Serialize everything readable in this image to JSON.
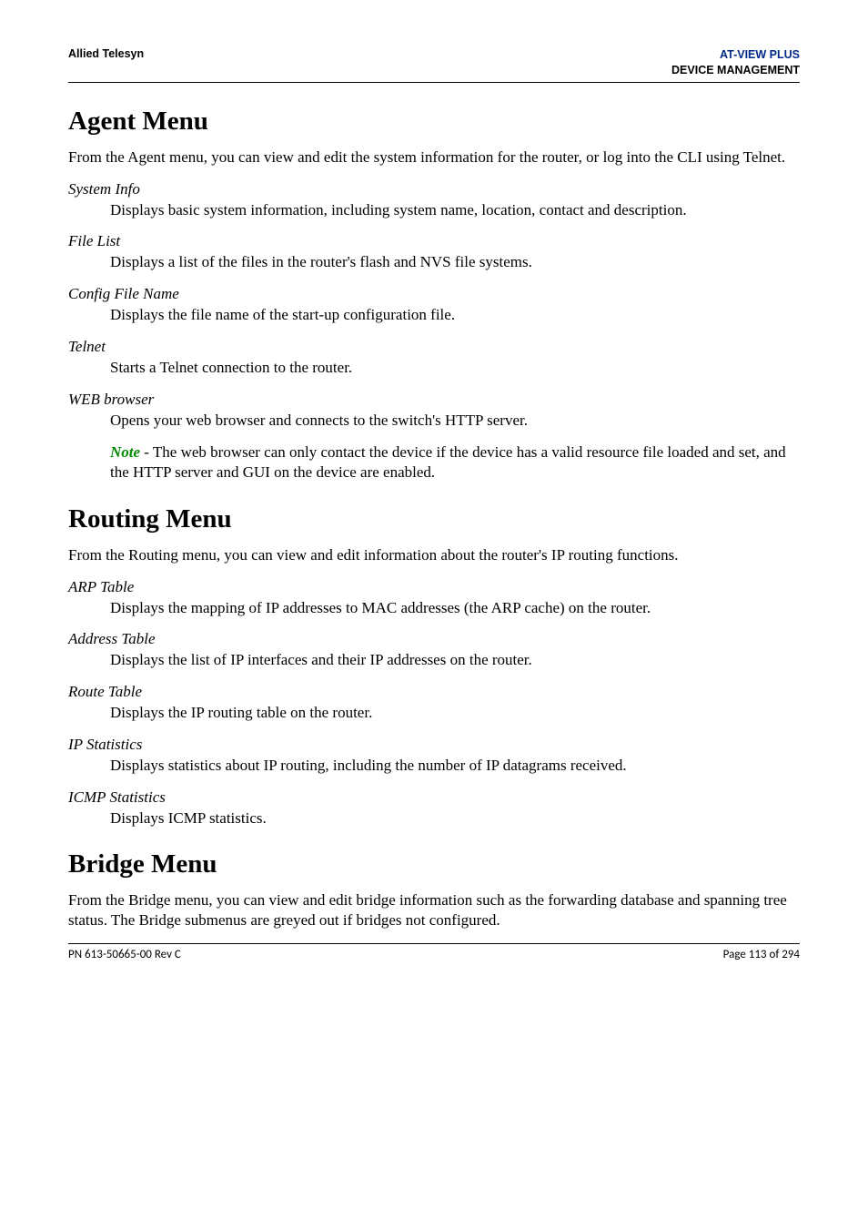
{
  "header": {
    "left": "Allied Telesyn",
    "right1": "AT-VIEW PLUS",
    "right2": "DEVICE MANAGEMENT"
  },
  "sections": [
    {
      "title": "Agent Menu",
      "intro": "From the Agent menu, you can view and edit the system information for the router, or log into the CLI using Telnet.",
      "items": [
        {
          "term": "System Info",
          "def": "Displays basic system information, including system name, location, contact and description."
        },
        {
          "term": "File List",
          "def": "Displays a list of the files in the router's flash and NVS file systems."
        },
        {
          "term": "Config File Name",
          "def": "Displays the file name of the start-up configuration file."
        },
        {
          "term": "Telnet",
          "def": "Starts a Telnet connection to the router."
        },
        {
          "term": "WEB browser",
          "def": "Opens your web browser and connects to the switch's HTTP server."
        }
      ],
      "note_label": "Note",
      "note_rest": " - The web browser can only contact the device if the device has a valid resource file loaded and set, and the HTTP server and GUI on the device are enabled."
    },
    {
      "title": "Routing Menu",
      "intro": "From the Routing menu, you can view and edit information about the router's IP routing functions.",
      "items": [
        {
          "term": "ARP Table",
          "def": "Displays the mapping of IP addresses to MAC addresses (the ARP cache) on the router."
        },
        {
          "term": "Address Table",
          "def": "Displays the list of IP interfaces and their IP addresses on the router."
        },
        {
          "term": "Route Table",
          "def": "Displays the IP routing table on the router."
        },
        {
          "term": "IP Statistics",
          "def": "Displays statistics about IP routing, including the number of IP datagrams received."
        },
        {
          "term": "ICMP Statistics",
          "def": "Displays ICMP statistics."
        }
      ]
    },
    {
      "title": "Bridge Menu",
      "intro": "From the Bridge menu, you can view and edit bridge information such as the forwarding database and spanning tree status. The Bridge submenus are greyed out if bridges not configured."
    }
  ],
  "footer": {
    "left": "PN 613-50665-00 Rev C",
    "right": "Page 113 of 294"
  }
}
